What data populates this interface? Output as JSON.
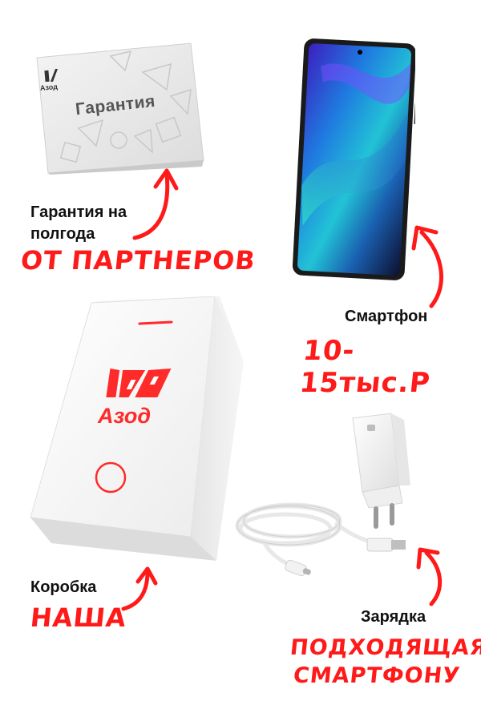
{
  "warranty": {
    "card_title": "Гарантия",
    "card_logo_text": "Азод",
    "caption": [
      "Гарантия на",
      "полгода"
    ],
    "tag": "ОТ ПАРТНЕРОВ"
  },
  "phone": {
    "caption": "Смартфон",
    "tag": "10-15тыс.Р"
  },
  "box": {
    "logo_text": "Азод",
    "caption": "Коробка",
    "tag": "НАША"
  },
  "charger": {
    "caption": "Зарядка",
    "tag": [
      "ПОДХОДЯЩАЯ",
      "СМАРТФОНУ"
    ]
  },
  "colors": {
    "accent": "#ff1a1a",
    "text": "#111111",
    "background": "#ffffff"
  }
}
